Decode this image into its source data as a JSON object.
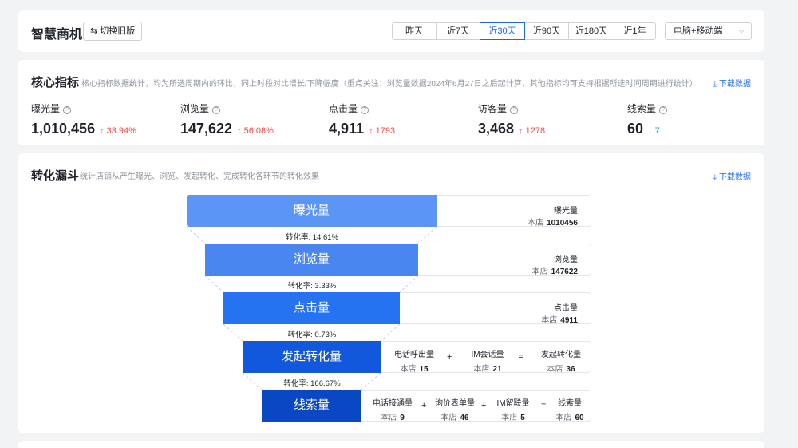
{
  "header": {
    "title": "智慧商机",
    "switch_label": "切换旧版",
    "ranges": [
      "昨天",
      "近7天",
      "近30天",
      "近90天",
      "近180天",
      "近1年"
    ],
    "active_range": "近30天",
    "device": "电脑+移动端"
  },
  "core": {
    "title": "核心指标",
    "desc": "核心指标数据统计，均为所选周期内的环比，同上时段对比增长/下降幅度（重点关注：浏览量数据2024年6月27日之后起计算，其他指标均可支持根据所选时间周期进行统计）",
    "download": "下载数据",
    "metrics": [
      {
        "label": "曝光量",
        "value": "1,010,456",
        "change": "33.94%",
        "dir": "up"
      },
      {
        "label": "浏览量",
        "value": "147,622",
        "change": "56.08%",
        "dir": "up"
      },
      {
        "label": "点击量",
        "value": "4,911",
        "change": "1793",
        "dir": "up"
      },
      {
        "label": "访客量",
        "value": "3,468",
        "change": "1278",
        "dir": "up"
      },
      {
        "label": "线索量",
        "value": "60",
        "change": "7",
        "dir": "down"
      }
    ]
  },
  "funnel": {
    "title": "转化漏斗",
    "desc": "统计店铺从产生曝光、浏览、发起转化、完成转化各环节的转化效果",
    "download": "下载数据",
    "store_label": "本店",
    "stages": [
      {
        "label": "曝光量",
        "box_title": "曝光量",
        "value": "1010456",
        "color": "#5b96f7"
      },
      {
        "label": "浏览量",
        "box_title": "浏览量",
        "value": "147622",
        "color": "#4a86f0"
      },
      {
        "label": "点击量",
        "box_title": "点击量",
        "value": "4911",
        "color": "#2673f2"
      },
      {
        "label": "发起转化量",
        "color": "#1258dd"
      },
      {
        "label": "线索量",
        "color": "#0a47c2"
      }
    ],
    "rates": [
      "转化率: 14.61%",
      "转化率: 3.33%",
      "转化率: 0.73%",
      "转化率: 166.67%"
    ],
    "initiate": {
      "parts": [
        {
          "title": "电话呼出量",
          "value": "15"
        },
        {
          "title": "IM会话量",
          "value": "21"
        }
      ],
      "result": {
        "title": "发起转化量",
        "value": "36"
      },
      "plus": "+",
      "equals": "="
    },
    "leads": {
      "parts": [
        {
          "title": "电话接通量",
          "value": "9"
        },
        {
          "title": "询价表单量",
          "value": "46"
        },
        {
          "title": "IM留联量",
          "value": "5"
        }
      ],
      "result": {
        "title": "线索量",
        "value": "60"
      },
      "plus": "+",
      "equals": "="
    }
  }
}
